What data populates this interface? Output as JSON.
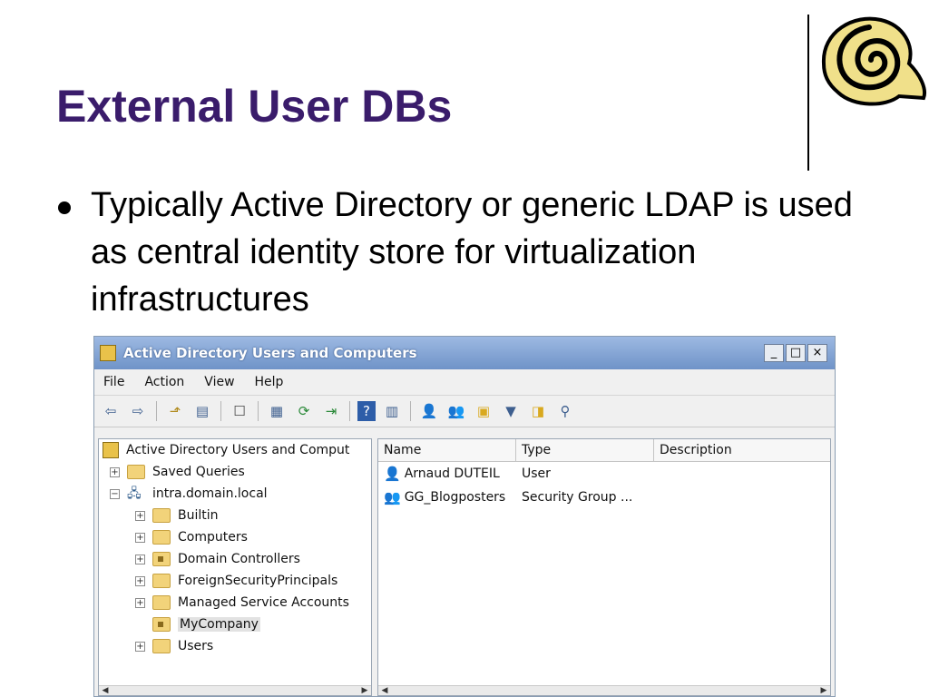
{
  "slide": {
    "title": "External User DBs",
    "bullet": "Typically Active Directory or generic LDAP is used as central identity store for virtualization infrastructures"
  },
  "window": {
    "title": "Active Directory Users and Computers",
    "controls": {
      "minimize": "_",
      "maximize": "□",
      "close": "×"
    },
    "menu": [
      "File",
      "Action",
      "View",
      "Help"
    ],
    "toolbar_icons": [
      "back-icon",
      "forward-icon",
      "up-icon",
      "show-tree-icon",
      "delete-icon",
      "properties-icon",
      "refresh-icon",
      "export-icon",
      "help-icon",
      "view-icon",
      "add-user-icon",
      "add-group-icon",
      "add-ou-icon",
      "filter-icon",
      "find-icon",
      "delegate-icon"
    ],
    "tree": {
      "root": "Active Directory Users and Comput",
      "items": [
        {
          "label": "Saved Queries",
          "level": 1,
          "expander": "+"
        },
        {
          "label": "intra.domain.local",
          "level": 1,
          "expander": "−"
        },
        {
          "label": "Builtin",
          "level": 2,
          "expander": "+"
        },
        {
          "label": "Computers",
          "level": 2,
          "expander": "+"
        },
        {
          "label": "Domain Controllers",
          "level": 2,
          "expander": "+"
        },
        {
          "label": "ForeignSecurityPrincipals",
          "level": 2,
          "expander": "+"
        },
        {
          "label": "Managed Service Accounts",
          "level": 2,
          "expander": "+"
        },
        {
          "label": "MyCompany",
          "level": 2,
          "expander": "",
          "selected": true
        },
        {
          "label": "Users",
          "level": 2,
          "expander": "+"
        }
      ]
    },
    "list": {
      "columns": [
        "Name",
        "Type",
        "Description"
      ],
      "rows": [
        {
          "name": "Arnaud DUTEIL",
          "type": "User",
          "description": ""
        },
        {
          "name": "GG_Blogposters",
          "type": "Security Group ...",
          "description": ""
        }
      ]
    }
  }
}
